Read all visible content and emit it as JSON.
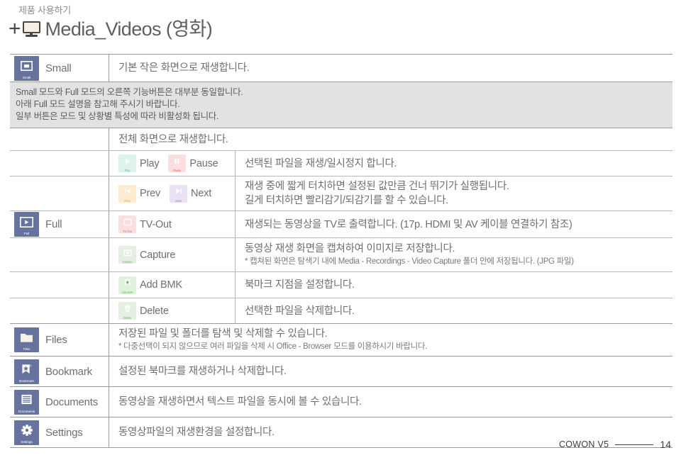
{
  "header": {
    "breadcrumb": "제품 사용하기",
    "plus": "+",
    "title": "Media_Videos (영화)",
    "title_icon": "monitor-icon"
  },
  "note": {
    "lines": [
      "Small 모드와 Full 모드의 오른쪽 기능버튼은 대부분 동일합니다.",
      "아래 Full 모드 설명을 참고해 주시기 바랍니다.",
      "일부 버튼은 모드 및 상황별 특성에 따라 비활성화 됩니다."
    ]
  },
  "modes": {
    "small": {
      "label": "Small",
      "caption": "Small",
      "icon": "small-screen-icon"
    },
    "full": {
      "label": "Full",
      "caption": "Full",
      "icon": "full-screen-icon"
    },
    "files": {
      "label": "Files",
      "caption": "Files",
      "icon": "folder-icon"
    },
    "bookmark": {
      "label": "Bookmark",
      "caption": "Bookmark",
      "icon": "bookmark-star-icon"
    },
    "documents": {
      "label": "Documents",
      "caption": "Documents",
      "icon": "documents-icon"
    },
    "settings": {
      "label": "Settings",
      "caption": "Settings",
      "icon": "gear-icon"
    }
  },
  "rows": {
    "small_desc": "기본 작은 화면으로 재생합니다.",
    "full_desc": "전체 화면으로 재생합니다.",
    "play_desc": "선택된 파일을 재생/일시정지 합니다.",
    "prev_next_desc_1": "재생 중에 짧게 터치하면 설정된 값만큼 건너 뛰기가 실행됩니다.",
    "prev_next_desc_2": "길게 터치하면 빨리감기/되감기를 할 수 있습니다.",
    "tvout_desc": "재생되는 동영상을 TV로 출력합니다. (17p. HDMI 및 AV 케이블 연결하기 참조)",
    "capture_desc": "동영상 재생 화면을 캡쳐하여 이미지로 저장합니다.",
    "capture_desc_sub": "* 캡쳐된 화면은 탐색기 내에 Media - Recordings - Video Capture 폴더 안에 저장됩니다. (JPG 파일)",
    "addbmk_desc": "북마크 지점을 설정합니다.",
    "delete_desc": "선택한 파일을 삭제합니다.",
    "files_desc": "저장된 파일 및 폴더를 탐색 및 삭제할 수 있습니다.",
    "files_desc_sub": "* 다중선택이 되지 않으므로 여러 파일을 삭제 시 Office - Browser 모드를 이용하시기 바랍니다.",
    "bookmark_desc": "설정된 북마크를 재생하거나 삭제합니다.",
    "documents_desc": "동영상을 재생하면서 텍스트 파일을 동시에 볼 수 있습니다.",
    "settings_desc": "동영상파일의 재생환경을 설정합니다."
  },
  "buttons": {
    "play": {
      "label": "Play",
      "caption": "Play",
      "color": "#5bbfa6",
      "bg": "#ddf2ec",
      "icon": "play-icon"
    },
    "pause": {
      "label": "Pause",
      "caption": "Pause",
      "color": "#e2656a",
      "bg": "#fbdedf",
      "icon": "pause-icon"
    },
    "prev": {
      "label": "Prev",
      "caption": "Prev",
      "color": "#f0a13c",
      "bg": "#fdeacf",
      "icon": "prev-icon"
    },
    "next": {
      "label": "Next",
      "caption": "Next",
      "color": "#9c7fc4",
      "bg": "#eae2f4",
      "icon": "next-icon"
    },
    "tvout": {
      "label": "TV-Out",
      "caption": "TV Out",
      "color": "#e2656a",
      "bg": "#fbdedf",
      "icon": "tv-out-icon"
    },
    "capture": {
      "label": "Capture",
      "caption": "Capture",
      "color": "#7fae7f",
      "bg": "#e4eee1",
      "icon": "camera-icon"
    },
    "addbmk": {
      "label": "Add BMK",
      "caption": "Add BMK",
      "color": "#6cbf5e",
      "bg": "#e0f1dc",
      "icon": "bookmark-add-icon"
    },
    "delete": {
      "label": "Delete",
      "caption": "Delete",
      "color": "#7fae7f",
      "bg": "#e4eee1",
      "icon": "trash-icon"
    }
  },
  "footer": {
    "brand": "COWON V5",
    "page": "14"
  },
  "colors": {
    "mode_icon_bg": "#66739f",
    "note_bg": "#e2e2e2",
    "text": "#6f6f6f",
    "border": "#9a9a9a"
  }
}
